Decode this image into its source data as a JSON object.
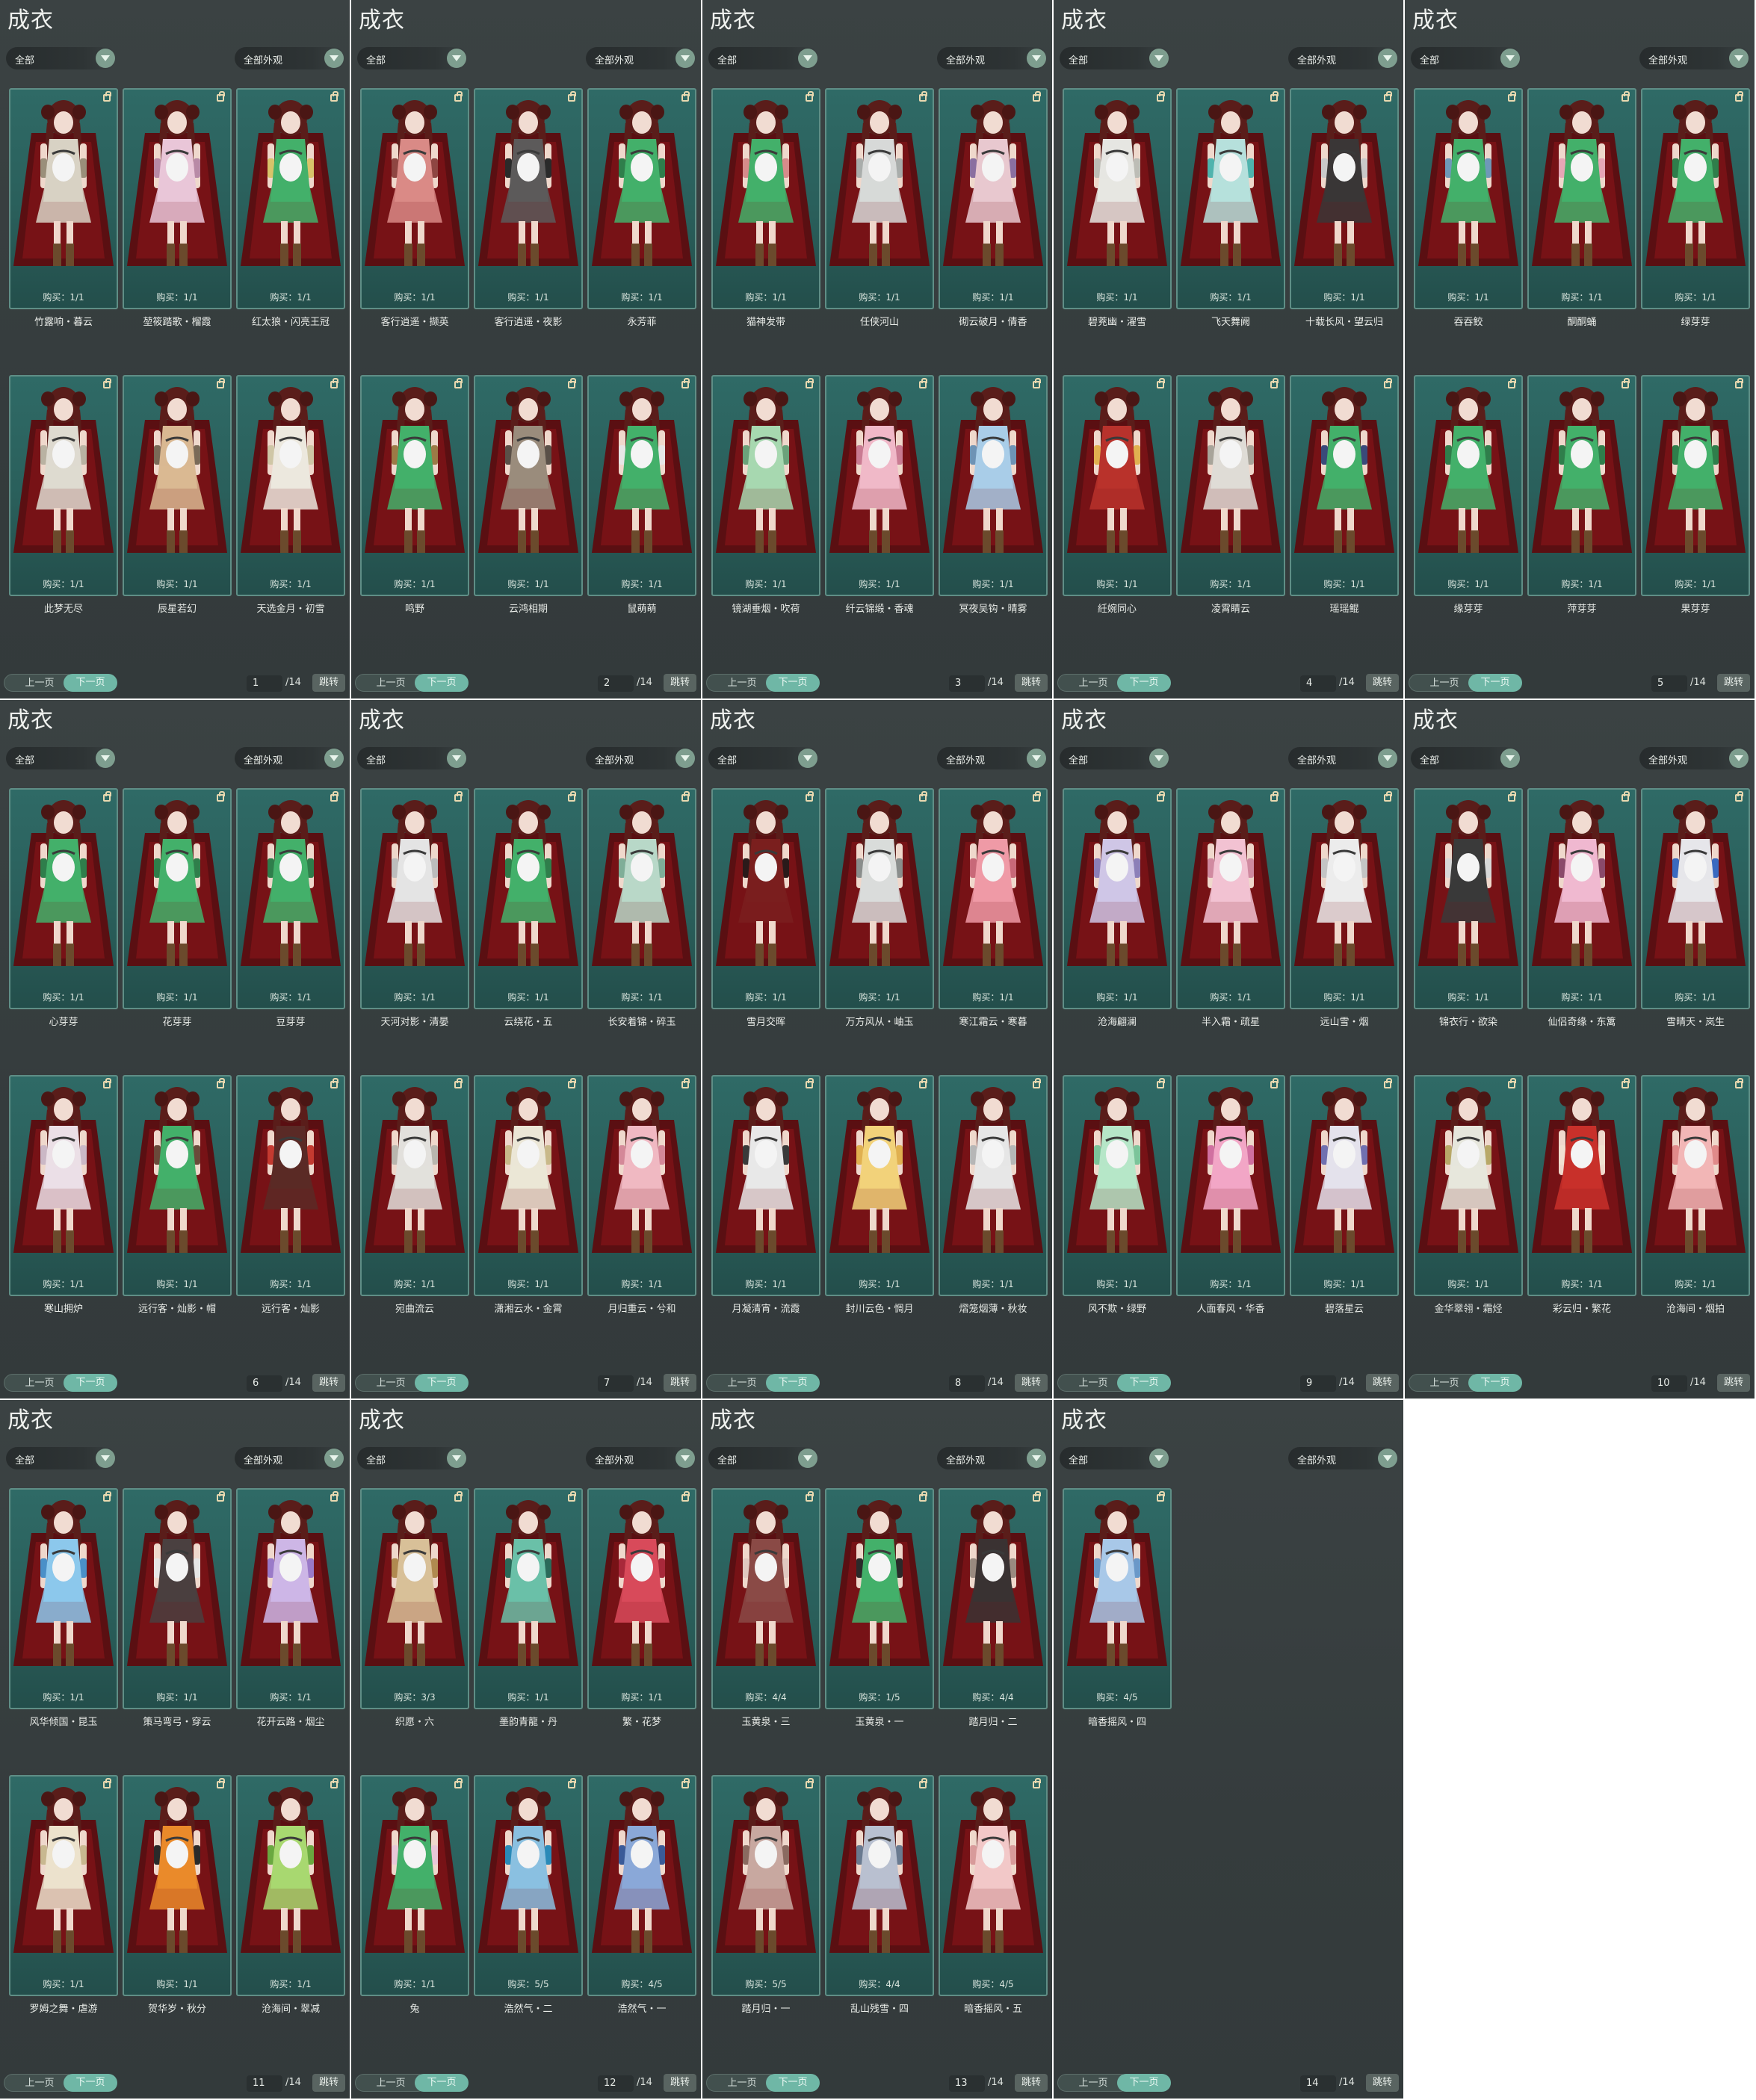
{
  "pages": [
    {
      "title": "成衣",
      "category": "全部",
      "appearance": "全部外观",
      "prev_label": "上一页",
      "next_label": "下一页",
      "page_number": "1",
      "page_total": "/14",
      "jump_label": "跳转",
      "items": [
        {
          "name": "竹露响・暮云",
          "buy": "购买：1/1",
          "outfit": "#d8d2c4",
          "accent": "#9a8f7a"
        },
        {
          "name": "堃筱踏歌・榴霞",
          "buy": "购买：1/1",
          "outfit": "#e9c6d8",
          "accent": "#b88aa6"
        },
        {
          "name": "红太狼・闪亮王冠",
          "buy": "购买：1/1",
          "outfit": "#43b06a",
          "accent": "#d8c36a"
        },
        {
          "name": "此梦无尽",
          "buy": "购买：1/1",
          "outfit": "#dedad0",
          "accent": "#b9b2a2"
        },
        {
          "name": "辰星若幻",
          "buy": "购买：1/1",
          "outfit": "#d9b892",
          "accent": "#7a6a58"
        },
        {
          "name": "天选金月・初雪",
          "buy": "购买：1/1",
          "outfit": "#ece8de",
          "accent": "#cfc6a6"
        }
      ]
    },
    {
      "title": "成衣",
      "category": "全部",
      "appearance": "全部外观",
      "prev_label": "上一页",
      "next_label": "下一页",
      "page_number": "2",
      "page_total": "/14",
      "jump_label": "跳转",
      "items": [
        {
          "name": "客行逍遥・撷英",
          "buy": "购买：1/1",
          "outfit": "#d98a86",
          "accent": "#8e4642"
        },
        {
          "name": "客行逍遥・夜影",
          "buy": "购买：1/1",
          "outfit": "#5c5a5a",
          "accent": "#2a2a2a"
        },
        {
          "name": "永芳菲",
          "buy": "购买：1/1",
          "outfit": "#43b06a",
          "accent": "#2f7e4b"
        },
        {
          "name": "鸣野",
          "buy": "购买：1/1",
          "outfit": "#43b06a",
          "accent": "#9c7a46"
        },
        {
          "name": "云鸿相期",
          "buy": "购买：1/1",
          "outfit": "#9a8c7c",
          "accent": "#5a5048"
        },
        {
          "name": "鼠萌萌",
          "buy": "购买：1/1",
          "outfit": "#43b06a",
          "accent": "#e6e6e6"
        }
      ]
    },
    {
      "title": "成衣",
      "category": "全部",
      "appearance": "全部外观",
      "prev_label": "上一页",
      "next_label": "下一页",
      "page_number": "3",
      "page_total": "/14",
      "jump_label": "跳转",
      "items": [
        {
          "name": "猫神发带",
          "buy": "购买：1/1",
          "outfit": "#43b06a",
          "accent": "#d68b8b"
        },
        {
          "name": "任侠河山",
          "buy": "购买：1/1",
          "outfit": "#d7d9d8",
          "accent": "#a9adab"
        },
        {
          "name": "砌云破月・倩香",
          "buy": "购买：1/1",
          "outfit": "#e8c8cf",
          "accent": "#8a6fa0"
        },
        {
          "name": "镜湖垂烟・吹荷",
          "buy": "购买：1/1",
          "outfit": "#a7d8b0",
          "accent": "#6ba27a"
        },
        {
          "name": "纤云锦缎・香魂",
          "buy": "购买：1/1",
          "outfit": "#f0b8c8",
          "accent": "#c97b92"
        },
        {
          "name": "冥夜吴钩・晴雾",
          "buy": "购买：1/1",
          "outfit": "#a9cde8",
          "accent": "#6e93b5"
        }
      ]
    },
    {
      "title": "成衣",
      "category": "全部",
      "appearance": "全部外观",
      "prev_label": "上一页",
      "next_label": "下一页",
      "page_number": "4",
      "page_total": "/14",
      "jump_label": "跳转",
      "items": [
        {
          "name": "碧茺幽・濯雪",
          "buy": "购买：1/1",
          "outfit": "#e6e6e2",
          "accent": "#bdbdb6"
        },
        {
          "name": "飞天舞阙",
          "buy": "购买：1/1",
          "outfit": "#b6e0dc",
          "accent": "#4fb3ad"
        },
        {
          "name": "十载长风・望云归",
          "buy": "购买：1/1",
          "outfit": "#3a3636",
          "accent": "#c9c9c9"
        },
        {
          "name": "紝婉同心",
          "buy": "购买：1/1",
          "outfit": "#b8322c",
          "accent": "#e0b050"
        },
        {
          "name": "凌霄睛云",
          "buy": "购买：1/1",
          "outfit": "#dfdcd6",
          "accent": "#a8a49a"
        },
        {
          "name": "瑶瑶鲲",
          "buy": "购买：1/1",
          "outfit": "#43b06a",
          "accent": "#3a4a7a"
        }
      ]
    },
    {
      "title": "成衣",
      "category": "全部",
      "appearance": "全部外观",
      "prev_label": "上一页",
      "next_label": "下一页",
      "page_number": "5",
      "page_total": "/14",
      "jump_label": "跳转",
      "items": [
        {
          "name": "吞吞鲛",
          "buy": "购买：1/1",
          "outfit": "#43b06a",
          "accent": "#6f98b8"
        },
        {
          "name": "酮酮蛹",
          "buy": "购买：1/1",
          "outfit": "#43b06a",
          "accent": "#e6a6b6"
        },
        {
          "name": "绿芽芽",
          "buy": "购买：1/1",
          "outfit": "#43b06a",
          "accent": "#2f7e4b"
        },
        {
          "name": "缘芽芽",
          "buy": "购买：1/1",
          "outfit": "#43b06a",
          "accent": "#2f7e4b"
        },
        {
          "name": "萍芽芽",
          "buy": "购买：1/1",
          "outfit": "#43b06a",
          "accent": "#2f7e4b"
        },
        {
          "name": "果芽芽",
          "buy": "购买：1/1",
          "outfit": "#43b06a",
          "accent": "#2f7e4b"
        }
      ]
    },
    {
      "title": "成衣",
      "category": "全部",
      "appearance": "全部外观",
      "prev_label": "上一页",
      "next_label": "下一页",
      "page_number": "6",
      "page_total": "/14",
      "jump_label": "跳转",
      "items": [
        {
          "name": "心芽芽",
          "buy": "购买：1/1",
          "outfit": "#43b06a",
          "accent": "#2f7e4b"
        },
        {
          "name": "花芽芽",
          "buy": "购买：1/1",
          "outfit": "#43b06a",
          "accent": "#2f7e4b"
        },
        {
          "name": "豆芽芽",
          "buy": "购买：1/1",
          "outfit": "#43b06a",
          "accent": "#2f7e4b"
        },
        {
          "name": "寒山拥炉",
          "buy": "购买：1/1",
          "outfit": "#ebdfe6",
          "accent": "#cbb8c6"
        },
        {
          "name": "远行客・灿影・帽",
          "buy": "购买：1/1",
          "outfit": "#43b06a",
          "accent": "#6a4a3a"
        },
        {
          "name": "远行客・灿影",
          "buy": "购买：1/1",
          "outfit": "#5a2a26",
          "accent": "#c43a30"
        }
      ]
    },
    {
      "title": "成衣",
      "category": "全部",
      "appearance": "全部外观",
      "prev_label": "上一页",
      "next_label": "下一页",
      "page_number": "7",
      "page_total": "/14",
      "jump_label": "跳转",
      "items": [
        {
          "name": "天河对影・清晏",
          "buy": "购买：1/1",
          "outfit": "#e4e4e4",
          "accent": "#bcbcbc"
        },
        {
          "name": "云绕花・五",
          "buy": "购买：1/1",
          "outfit": "#43b06a",
          "accent": "#2f7e4b"
        },
        {
          "name": "长安着锦・碎玉",
          "buy": "购买：1/1",
          "outfit": "#b8d8c8",
          "accent": "#7fae98"
        },
        {
          "name": "宛曲流云",
          "buy": "购买：1/1",
          "outfit": "#e2e0dc",
          "accent": "#b9b6ae"
        },
        {
          "name": "潇湘云水・金霄",
          "buy": "购买：1/1",
          "outfit": "#ebe6d6",
          "accent": "#c9b98a"
        },
        {
          "name": "月归重云・兮和",
          "buy": "购买：1/1",
          "outfit": "#f0b8c2",
          "accent": "#d48898"
        }
      ]
    },
    {
      "title": "成衣",
      "category": "全部",
      "appearance": "全部外观",
      "prev_label": "上一页",
      "next_label": "下一页",
      "page_number": "8",
      "page_total": "/14",
      "jump_label": "跳转",
      "items": [
        {
          "name": "雪月交晖",
          "buy": "购买：1/1",
          "outfit": "#7a1f1e",
          "accent": "#2a1a1a"
        },
        {
          "name": "万方风从・岫玉",
          "buy": "购买：1/1",
          "outfit": "#d9dcda",
          "accent": "#8a8e8c"
        },
        {
          "name": "寒江霜云・寒暮",
          "buy": "购买：1/1",
          "outfit": "#ef9aa6",
          "accent": "#c86878"
        },
        {
          "name": "月凝清宵・流霞",
          "buy": "购买：1/1",
          "outfit": "#e8e8e8",
          "accent": "#3a3a3a"
        },
        {
          "name": "封川云色・惆月",
          "buy": "购买：1/1",
          "outfit": "#f2d27a",
          "accent": "#e0b050"
        },
        {
          "name": "熠笼烟薄・秋妆",
          "buy": "购买：1/1",
          "outfit": "#e6e6e6",
          "accent": "#b6b6b6"
        }
      ]
    },
    {
      "title": "成衣",
      "category": "全部",
      "appearance": "全部外观",
      "prev_label": "上一页",
      "next_label": "下一页",
      "page_number": "9",
      "page_total": "/14",
      "jump_label": "跳转",
      "items": [
        {
          "name": "沧海翩澜",
          "buy": "购买：1/1",
          "outfit": "#cfc6e6",
          "accent": "#8c7fb8"
        },
        {
          "name": "半入霜・疏星",
          "buy": "购买：1/1",
          "outfit": "#f2c2d2",
          "accent": "#d08aa0"
        },
        {
          "name": "远山雪・烟",
          "buy": "购买：1/1",
          "outfit": "#ececec",
          "accent": "#c4c4c4"
        },
        {
          "name": "风不欺・绿野",
          "buy": "购买：1/1",
          "outfit": "#b6e6c8",
          "accent": "#7cc49a"
        },
        {
          "name": "人面春风・华香",
          "buy": "购买：1/1",
          "outfit": "#f2a6c6",
          "accent": "#d070a0"
        },
        {
          "name": "碧落星云",
          "buy": "购买：1/1",
          "outfit": "#e4e2ec",
          "accent": "#7070b0"
        }
      ]
    },
    {
      "title": "成衣",
      "category": "全部",
      "appearance": "全部外观",
      "prev_label": "上一页",
      "next_label": "下一页",
      "page_number": "10",
      "page_total": "/14",
      "jump_label": "跳转",
      "items": [
        {
          "name": "锦衣行・欲染",
          "buy": "购买：1/1",
          "outfit": "#3a3a3a",
          "accent": "#d8d8d8"
        },
        {
          "name": "仙侣奇缘・东篱",
          "buy": "购买：1/1",
          "outfit": "#f0b8d0",
          "accent": "#8a4a6a"
        },
        {
          "name": "雪晴天・岚生",
          "buy": "购买：1/1",
          "outfit": "#e6e6ea",
          "accent": "#3a6ac0"
        },
        {
          "name": "金华翠翎・霜烃",
          "buy": "购买：1/1",
          "outfit": "#e6e6dc",
          "accent": "#b8a868"
        },
        {
          "name": "彩云归・繁花",
          "buy": "购买：1/1",
          "outfit": "#c8302a",
          "accent": "#f0e0d0"
        },
        {
          "name": "沧海间・烟拍",
          "buy": "购买：1/1",
          "outfit": "#f2b6b6",
          "accent": "#e08a8a"
        }
      ]
    },
    {
      "title": "成衣",
      "category": "全部",
      "appearance": "全部外观",
      "prev_label": "上一页",
      "next_label": "下一页",
      "page_number": "11",
      "page_total": "/14",
      "jump_label": "跳转",
      "items": [
        {
          "name": "风华倾国・昆玉",
          "buy": "购买：1/1",
          "outfit": "#8cc8ec",
          "accent": "#4a90c8"
        },
        {
          "name": "策马弯弓・穿云",
          "buy": "购买：1/1",
          "outfit": "#4a4040",
          "accent": "#e6e6e6"
        },
        {
          "name": "花开云路・烟尘",
          "buy": "购买：1/1",
          "outfit": "#cdb6e6",
          "accent": "#9a7ac8"
        },
        {
          "name": "罗姆之舞・虐游",
          "buy": "购买：1/1",
          "outfit": "#ece2cc",
          "accent": "#c8b890"
        },
        {
          "name": "贺华岁・秋分",
          "buy": "购买：1/1",
          "outfit": "#ea8a2a",
          "accent": "#2a2a2a"
        },
        {
          "name": "沧海间・翠减",
          "buy": "购买：1/1",
          "outfit": "#a8d870",
          "accent": "#6aa840"
        }
      ]
    },
    {
      "title": "成衣",
      "category": "全部",
      "appearance": "全部外观",
      "prev_label": "上一页",
      "next_label": "下一页",
      "page_number": "12",
      "page_total": "/14",
      "jump_label": "跳转",
      "items": [
        {
          "name": "织愿・六",
          "buy": "购买：3/3",
          "outfit": "#d8c098",
          "accent": "#b08a50"
        },
        {
          "name": "墨韵青龍・丹",
          "buy": "购买：1/1",
          "outfit": "#6ac0a8",
          "accent": "#2a6a5a"
        },
        {
          "name": "繁・花梦",
          "buy": "购买：1/1",
          "outfit": "#d84a5a",
          "accent": "#a8283a"
        },
        {
          "name": "兔",
          "buy": "购买：1/1",
          "outfit": "#43b06a",
          "accent": "#e8c8d8"
        },
        {
          "name": "浩然气・二",
          "buy": "购买：5/5",
          "outfit": "#8ac0e0",
          "accent": "#2a8ab8"
        },
        {
          "name": "浩然气・一",
          "buy": "购买：4/5",
          "outfit": "#8aa8d8",
          "accent": "#3a5a98"
        }
      ]
    },
    {
      "title": "成衣",
      "category": "全部",
      "appearance": "全部外观",
      "prev_label": "上一页",
      "next_label": "下一页",
      "page_number": "13",
      "page_total": "/14",
      "jump_label": "跳转",
      "items": [
        {
          "name": "玉黄泉・三",
          "buy": "购买：4/4",
          "outfit": "#8a4a46",
          "accent": "#e0c8c0"
        },
        {
          "name": "玉黄泉・一",
          "buy": "购买：1/5",
          "outfit": "#43b06a",
          "accent": "#2a2a2a"
        },
        {
          "name": "踏月归・二",
          "buy": "购买：4/4",
          "outfit": "#3a3232",
          "accent": "#9a8a80"
        },
        {
          "name": "踏月归・一",
          "buy": "购买：5/5",
          "outfit": "#c8a8a0",
          "accent": "#8a6a60"
        },
        {
          "name": "乱山残雪・四",
          "buy": "购买：4/4",
          "outfit": "#b8c0d0",
          "accent": "#6a7a90"
        },
        {
          "name": "暗香摇风・五",
          "buy": "购买：4/5",
          "outfit": "#f2c8c8",
          "accent": "#d89a9a"
        }
      ]
    },
    {
      "title": "成衣",
      "category": "全部",
      "appearance": "全部外观",
      "prev_label": "上一页",
      "next_label": "下一页",
      "page_number": "14",
      "page_total": "/14",
      "jump_label": "跳转",
      "items": [
        {
          "name": "暗香摇风・四",
          "buy": "购买：4/5",
          "outfit": "#a8c8e8",
          "accent": "#6a98c8"
        }
      ]
    }
  ]
}
